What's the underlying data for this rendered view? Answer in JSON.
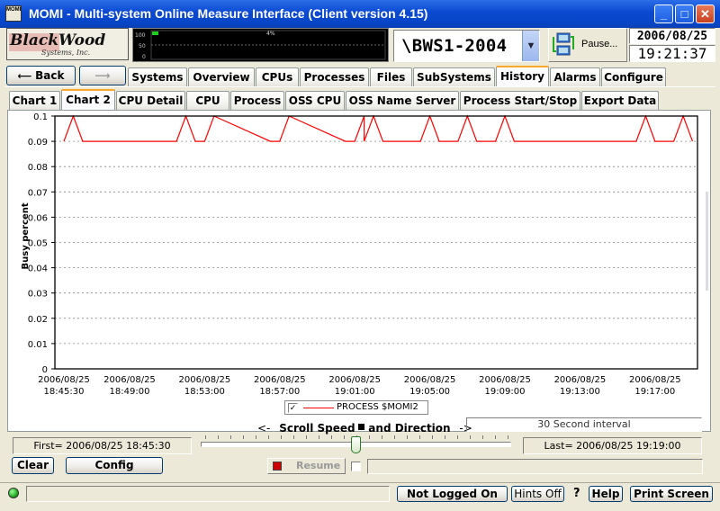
{
  "window": {
    "app_icon": "MOMI",
    "title": "MOMI - Multi-system Online Measure Interface (Client version 4.15)",
    "minimize": "_",
    "maximize": "□",
    "close": "✕"
  },
  "logo": {
    "line1": "BlackWood",
    "line2": "Systems, Inc."
  },
  "mini_graph": {
    "scale": [
      "100",
      "50",
      "0"
    ],
    "value_label": "4%"
  },
  "server": {
    "name": "\\BWS1-2004"
  },
  "pause_label": "Pause...",
  "clock": {
    "date": "2006/08/25",
    "time": "19:21:37"
  },
  "nav": {
    "back": "Back",
    "forward": "",
    "tabs": [
      "Systems",
      "Overview",
      "CPUs",
      "Processes",
      "Files",
      "SubSystems",
      "History",
      "Alarms",
      "Configure"
    ],
    "active_tab": "History"
  },
  "subtabs": {
    "items": [
      "Chart 1",
      "Chart 2",
      "CPU Detail",
      "CPU",
      "Process",
      "OSS CPU",
      "OSS Name Server",
      "Process Start/Stop",
      "Export Data"
    ],
    "active": "Chart 2"
  },
  "chart_data": {
    "type": "line",
    "ylabel": "Busy percent",
    "ylim": [
      0,
      0.1
    ],
    "yticks": [
      "0.1",
      "0.09",
      "0.08",
      "0.07",
      "0.06",
      "0.05",
      "0.04",
      "0.03",
      "0.02",
      "0.01",
      "0"
    ],
    "xticks": [
      [
        "2006/08/25",
        "18:45:30"
      ],
      [
        "2006/08/25",
        "18:49:00"
      ],
      [
        "2006/08/25",
        "18:53:00"
      ],
      [
        "2006/08/25",
        "18:57:00"
      ],
      [
        "2006/08/25",
        "19:01:00"
      ],
      [
        "2006/08/25",
        "19:05:00"
      ],
      [
        "2006/08/25",
        "19:09:00"
      ],
      [
        "2006/08/25",
        "19:13:00"
      ],
      [
        "2006/08/25",
        "19:17:00"
      ]
    ],
    "grid": "horizontal dashed",
    "series": [
      {
        "name": "PROCESS $MOMI2",
        "color": "#ff0000",
        "x": [
          "2006/08/25 18:45:30",
          "2006/08/25 18:46:00",
          "2006/08/25 18:46:30",
          "2006/08/25 18:51:30",
          "2006/08/25 18:52:00",
          "2006/08/25 18:52:30",
          "2006/08/25 18:53:00",
          "2006/08/25 18:53:30",
          "2006/08/25 18:56:30",
          "2006/08/25 18:57:00",
          "2006/08/25 18:57:30",
          "2006/08/25 19:00:30",
          "2006/08/25 19:01:00",
          "2006/08/25 19:01:30",
          "2006/08/25 19:01:30",
          "2006/08/25 19:02:00",
          "2006/08/25 19:02:30",
          "2006/08/25 19:04:30",
          "2006/08/25 19:05:00",
          "2006/08/25 19:05:30",
          "2006/08/25 19:06:30",
          "2006/08/25 19:07:00",
          "2006/08/25 19:07:30",
          "2006/08/25 19:08:30",
          "2006/08/25 19:09:00",
          "2006/08/25 19:09:30",
          "2006/08/25 19:16:00",
          "2006/08/25 19:16:30",
          "2006/08/25 19:17:00",
          "2006/08/25 19:18:00",
          "2006/08/25 19:18:30",
          "2006/08/25 19:19:00"
        ],
        "values": [
          0.09,
          0.1,
          0.09,
          0.09,
          0.1,
          0.09,
          0.09,
          0.1,
          0.09,
          0.09,
          0.1,
          0.09,
          0.09,
          0.1,
          0.09,
          0.1,
          0.09,
          0.09,
          0.1,
          0.09,
          0.09,
          0.1,
          0.09,
          0.09,
          0.1,
          0.09,
          0.09,
          0.1,
          0.09,
          0.09,
          0.1,
          0.09
        ]
      }
    ]
  },
  "legend": {
    "checked": "✓",
    "label": "PROCESS $MOMI2"
  },
  "scroll": {
    "label_left": "<-",
    "label": "Scroll Speed",
    "label_mid": "and Direction",
    "label_right": "->",
    "interval": "30 Second interval",
    "first": "First= 2006/08/25 18:45:30",
    "last": "Last= 2006/08/25 19:19:00",
    "slider_level": 0.5
  },
  "buttons": {
    "clear": "Clear",
    "config": "Config",
    "resume": "Resume"
  },
  "status": {
    "login": "Not Logged On",
    "hints": "Hints Off",
    "question": "?",
    "help": "Help",
    "print": "Print Screen"
  },
  "colors": {
    "titlebar": "#0a48d0",
    "series": "#ff0000",
    "active_tab_accent": "#f9a82a",
    "status_led": "#22aa22"
  }
}
